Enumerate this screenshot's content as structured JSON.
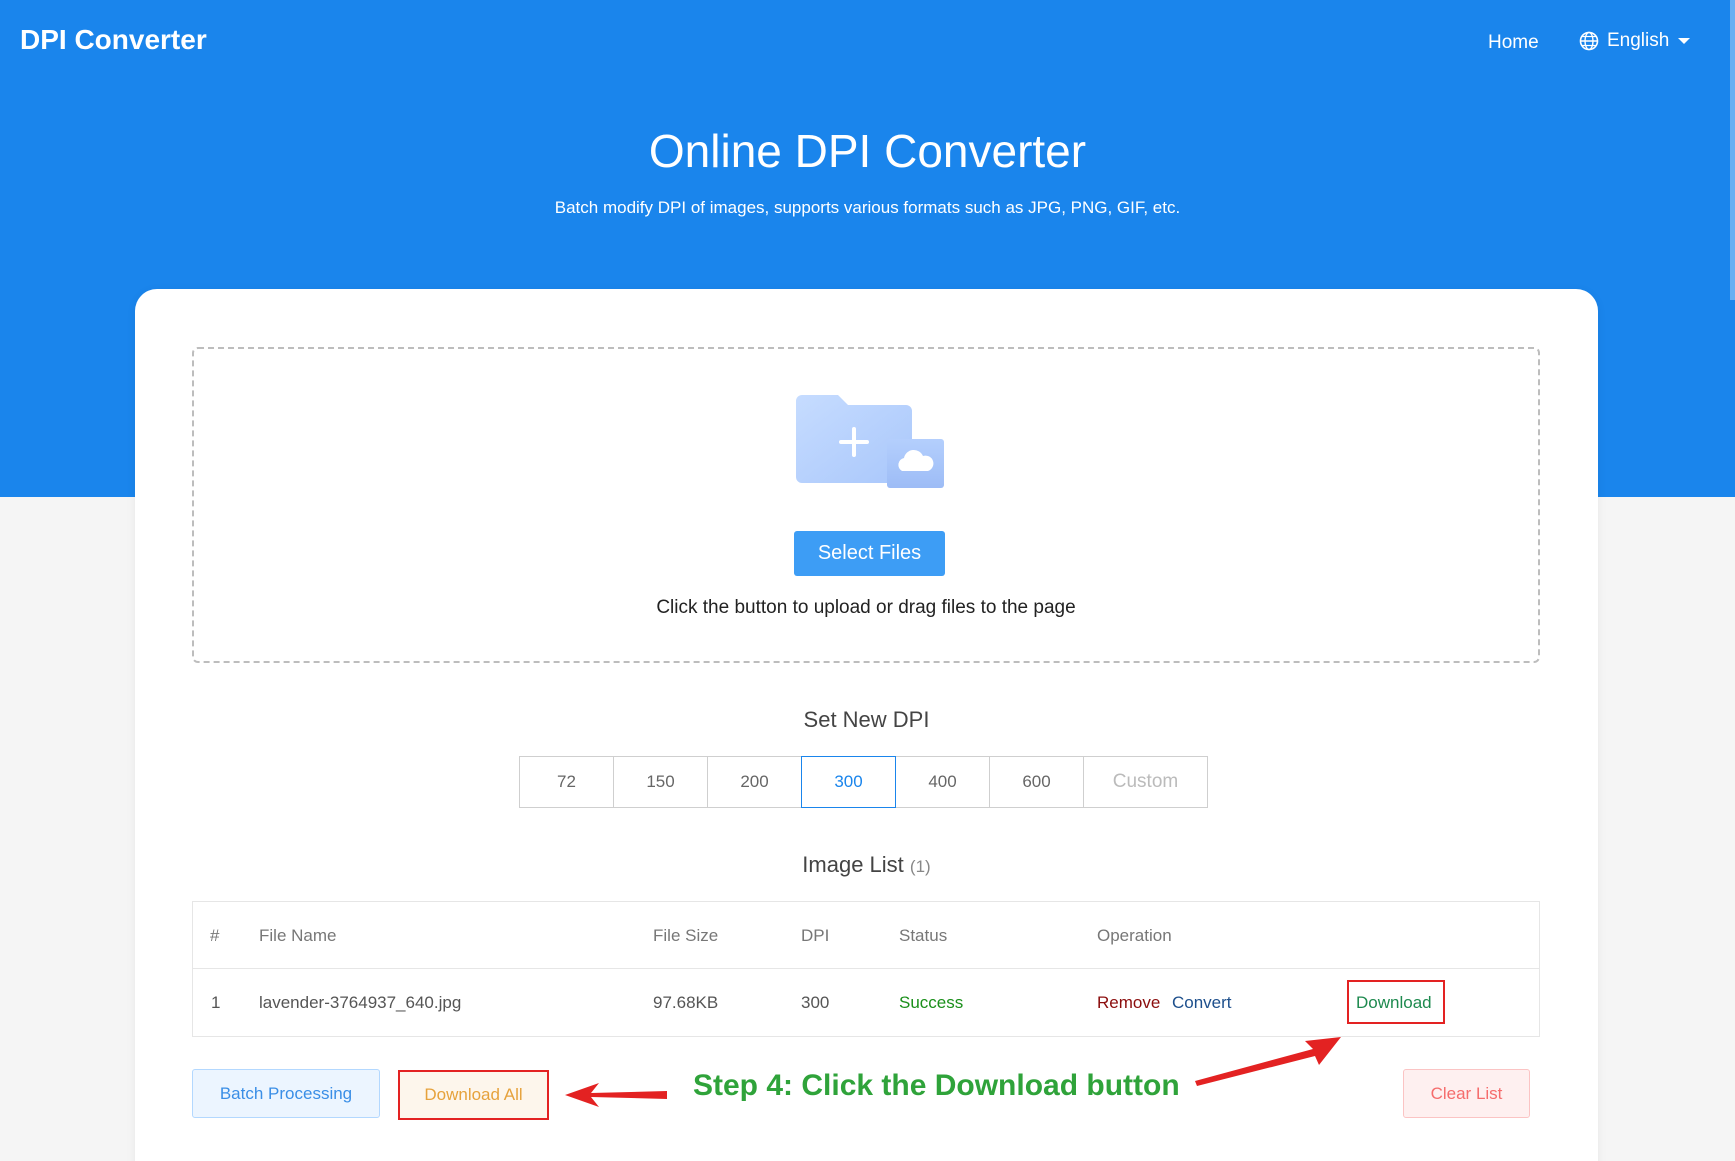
{
  "header": {
    "brand": "DPI Converter",
    "nav_home": "Home",
    "language": "English"
  },
  "hero": {
    "title": "Online DPI Converter",
    "subtitle": "Batch modify DPI of images, supports various formats such as JPG, PNG, GIF, etc."
  },
  "upload": {
    "select_label": "Select Files",
    "hint": "Click the button to upload or drag files to the page"
  },
  "dpi": {
    "title": "Set New DPI",
    "options": [
      "72",
      "150",
      "200",
      "300",
      "400",
      "600"
    ],
    "selected": "300",
    "custom_placeholder": "Custom"
  },
  "image_list": {
    "title": "Image List",
    "count": "(1)",
    "columns": [
      "#",
      "File Name",
      "File Size",
      "DPI",
      "Status",
      "Operation"
    ],
    "rows": [
      {
        "index": "1",
        "file_name": "lavender-3764937_640.jpg",
        "file_size": "97.68KB",
        "dpi": "300",
        "status": "Success",
        "ops": {
          "remove": "Remove",
          "convert": "Convert",
          "download": "Download"
        }
      }
    ]
  },
  "actions": {
    "batch": "Batch Processing",
    "download_all": "Download All",
    "clear": "Clear List"
  },
  "annotation": {
    "step_text": "Step 4: Click the Download button"
  },
  "colors": {
    "brand_blue": "#1a85ec",
    "highlight_red": "#e32222",
    "step_green": "#2fa33a"
  }
}
